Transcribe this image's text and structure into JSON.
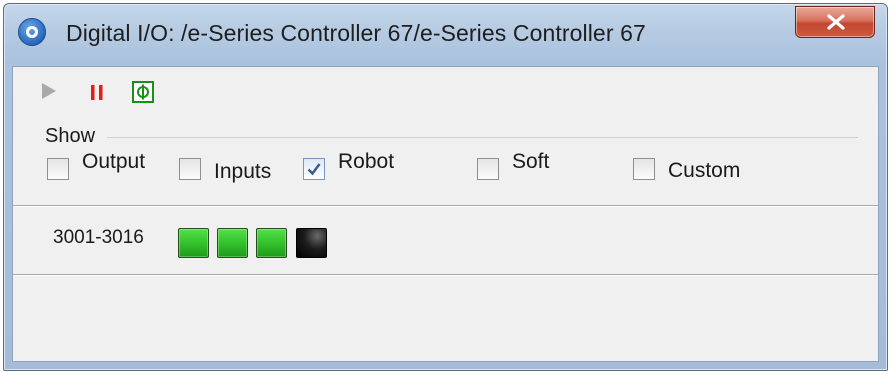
{
  "window": {
    "title": "Digital I/O: /e-Series Controller 67/e-Series Controller 67",
    "app_icon": "app-logo-icon",
    "close_icon": "close-icon"
  },
  "toolbar": {
    "buttons": [
      {
        "name": "play",
        "icon": "play-icon",
        "enabled": false
      },
      {
        "name": "pause",
        "icon": "pause-icon",
        "color": "#e0201b"
      },
      {
        "name": "refresh",
        "icon": "refresh-icon",
        "color": "#1a8f1a"
      }
    ]
  },
  "show": {
    "label": "Show",
    "options": [
      {
        "label": "Output",
        "checked": false
      },
      {
        "label": "Inputs",
        "checked": false
      },
      {
        "label": "Robot",
        "checked": true
      },
      {
        "label": "Soft",
        "checked": false
      },
      {
        "label": "Custom",
        "checked": false
      }
    ]
  },
  "io_rows": [
    {
      "range": "3001-3016",
      "signals": [
        true,
        true,
        true,
        false
      ]
    }
  ],
  "colors": {
    "led_on": "#34c22d",
    "led_off": "#000000",
    "close_button": "#c24731"
  }
}
